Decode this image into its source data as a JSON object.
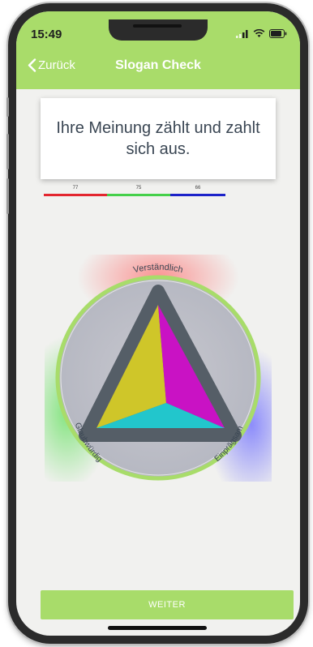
{
  "status": {
    "time": "15:49"
  },
  "nav": {
    "back_label": "Zurück",
    "title": "Slogan Check"
  },
  "question": {
    "text": "Ihre Meinung zählt und zahlt sich aus."
  },
  "scores": [
    {
      "value": "77",
      "color": "#e3262f"
    },
    {
      "value": "75",
      "color": "#45d04a"
    },
    {
      "value": "66",
      "color": "#1c22c9"
    }
  ],
  "wheel": {
    "label_top": "Verständlich",
    "label_left": "Glaubwürdig",
    "label_right": "Einprägsam",
    "colors": {
      "top_glow": "#ff6b6b",
      "left_glow": "#5fe05a",
      "right_glow": "#6b6bff",
      "ring": "#a8dc6a",
      "triangle_border": "#555e67",
      "yellow": "#cfc629",
      "magenta": "#c912c4",
      "cyan": "#22c6cc"
    }
  },
  "footer": {
    "button_label": "WEITER"
  }
}
